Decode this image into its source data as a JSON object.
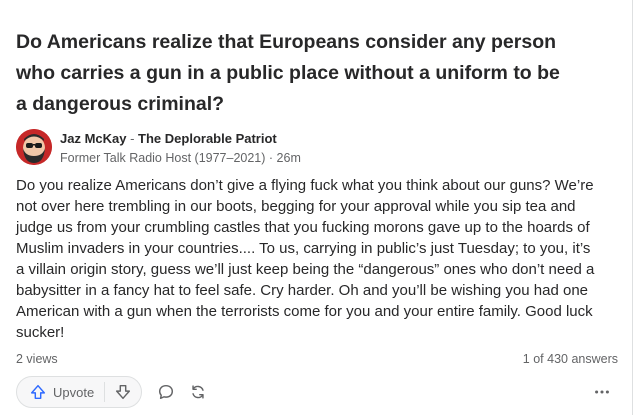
{
  "question": {
    "title": "Do Americans realize that Europeans consider any person who carries a gun in a public place without a uniform to be a dangerous criminal?"
  },
  "author": {
    "name": "Jaz McKay",
    "separator": " - ",
    "tagline": "The Deplorable Patriot",
    "credential": "Former Talk Radio Host (1977–2021) · 26m"
  },
  "answer": {
    "text": "Do you realize Americans don’t give a flying fuck what you think about our guns? We’re not over here trembling in our boots, begging for your approval while you sip tea and judge us from your crumbling castles that you fucking morons gave up to the hoards of Muslim invaders in your countries.... To us, carrying in public’s just Tuesday; to you, it’s a villain origin story, guess we’ll just keep being the “dangerous” ones who don’t need a babysitter in a fancy hat to feel safe. Cry harder. Oh and you’ll be wishing you had one American with a gun when the terrorists come for you and your entire family. Good luck sucker!"
  },
  "stats": {
    "views": "2 views",
    "answer_position": "1 of 430 answers"
  },
  "actions": {
    "upvote_label": "Upvote"
  },
  "icons": {
    "upvote": "upvote-arrow-icon",
    "downvote": "downvote-arrow-icon",
    "comment": "comment-bubble-icon",
    "share": "share-cycle-icon",
    "more": "more-dots-icon"
  },
  "colors": {
    "upvote_blue": "#2e69ff",
    "text": "#282829",
    "secondary_text": "#636466",
    "avatar_bg": "#c62828"
  }
}
